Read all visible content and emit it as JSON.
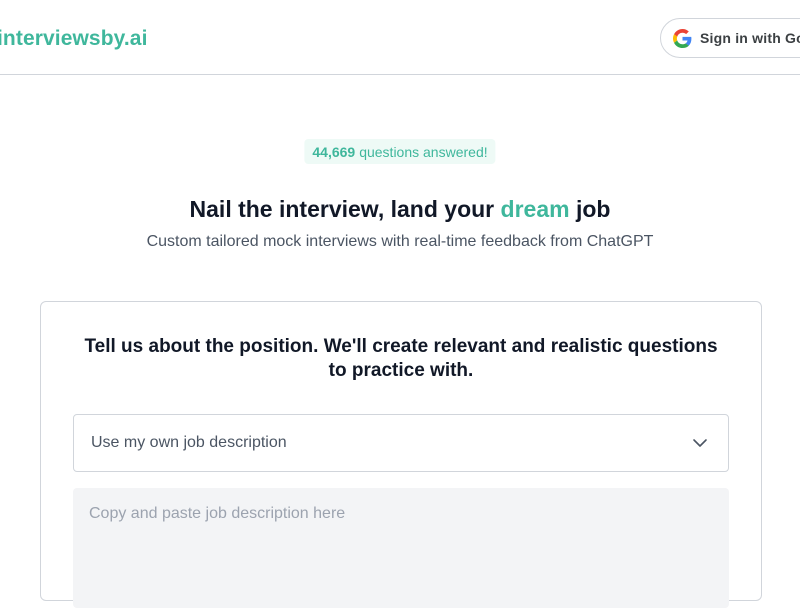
{
  "header": {
    "logo": "interviewsby.ai",
    "signin_label": "Sign in with Google"
  },
  "stats": {
    "count": "44,669",
    "text": "questions answered!"
  },
  "hero": {
    "headline_before": "Nail the interview, land your",
    "headline_accent": "dream",
    "headline_after": "job",
    "subtitle": "Custom tailored mock interviews with real-time feedback from ChatGPT"
  },
  "form": {
    "title": "Tell us about the position. We'll create relevant and realistic questions to practice with.",
    "select_value": "Use my own job description",
    "textarea_placeholder": "Copy and paste job description here"
  },
  "icons": {
    "signin": "google-icon",
    "select": "chevron-down-icon"
  },
  "colors": {
    "accent": "#3fb79c",
    "text": "#111827",
    "muted": "#4b5563"
  }
}
